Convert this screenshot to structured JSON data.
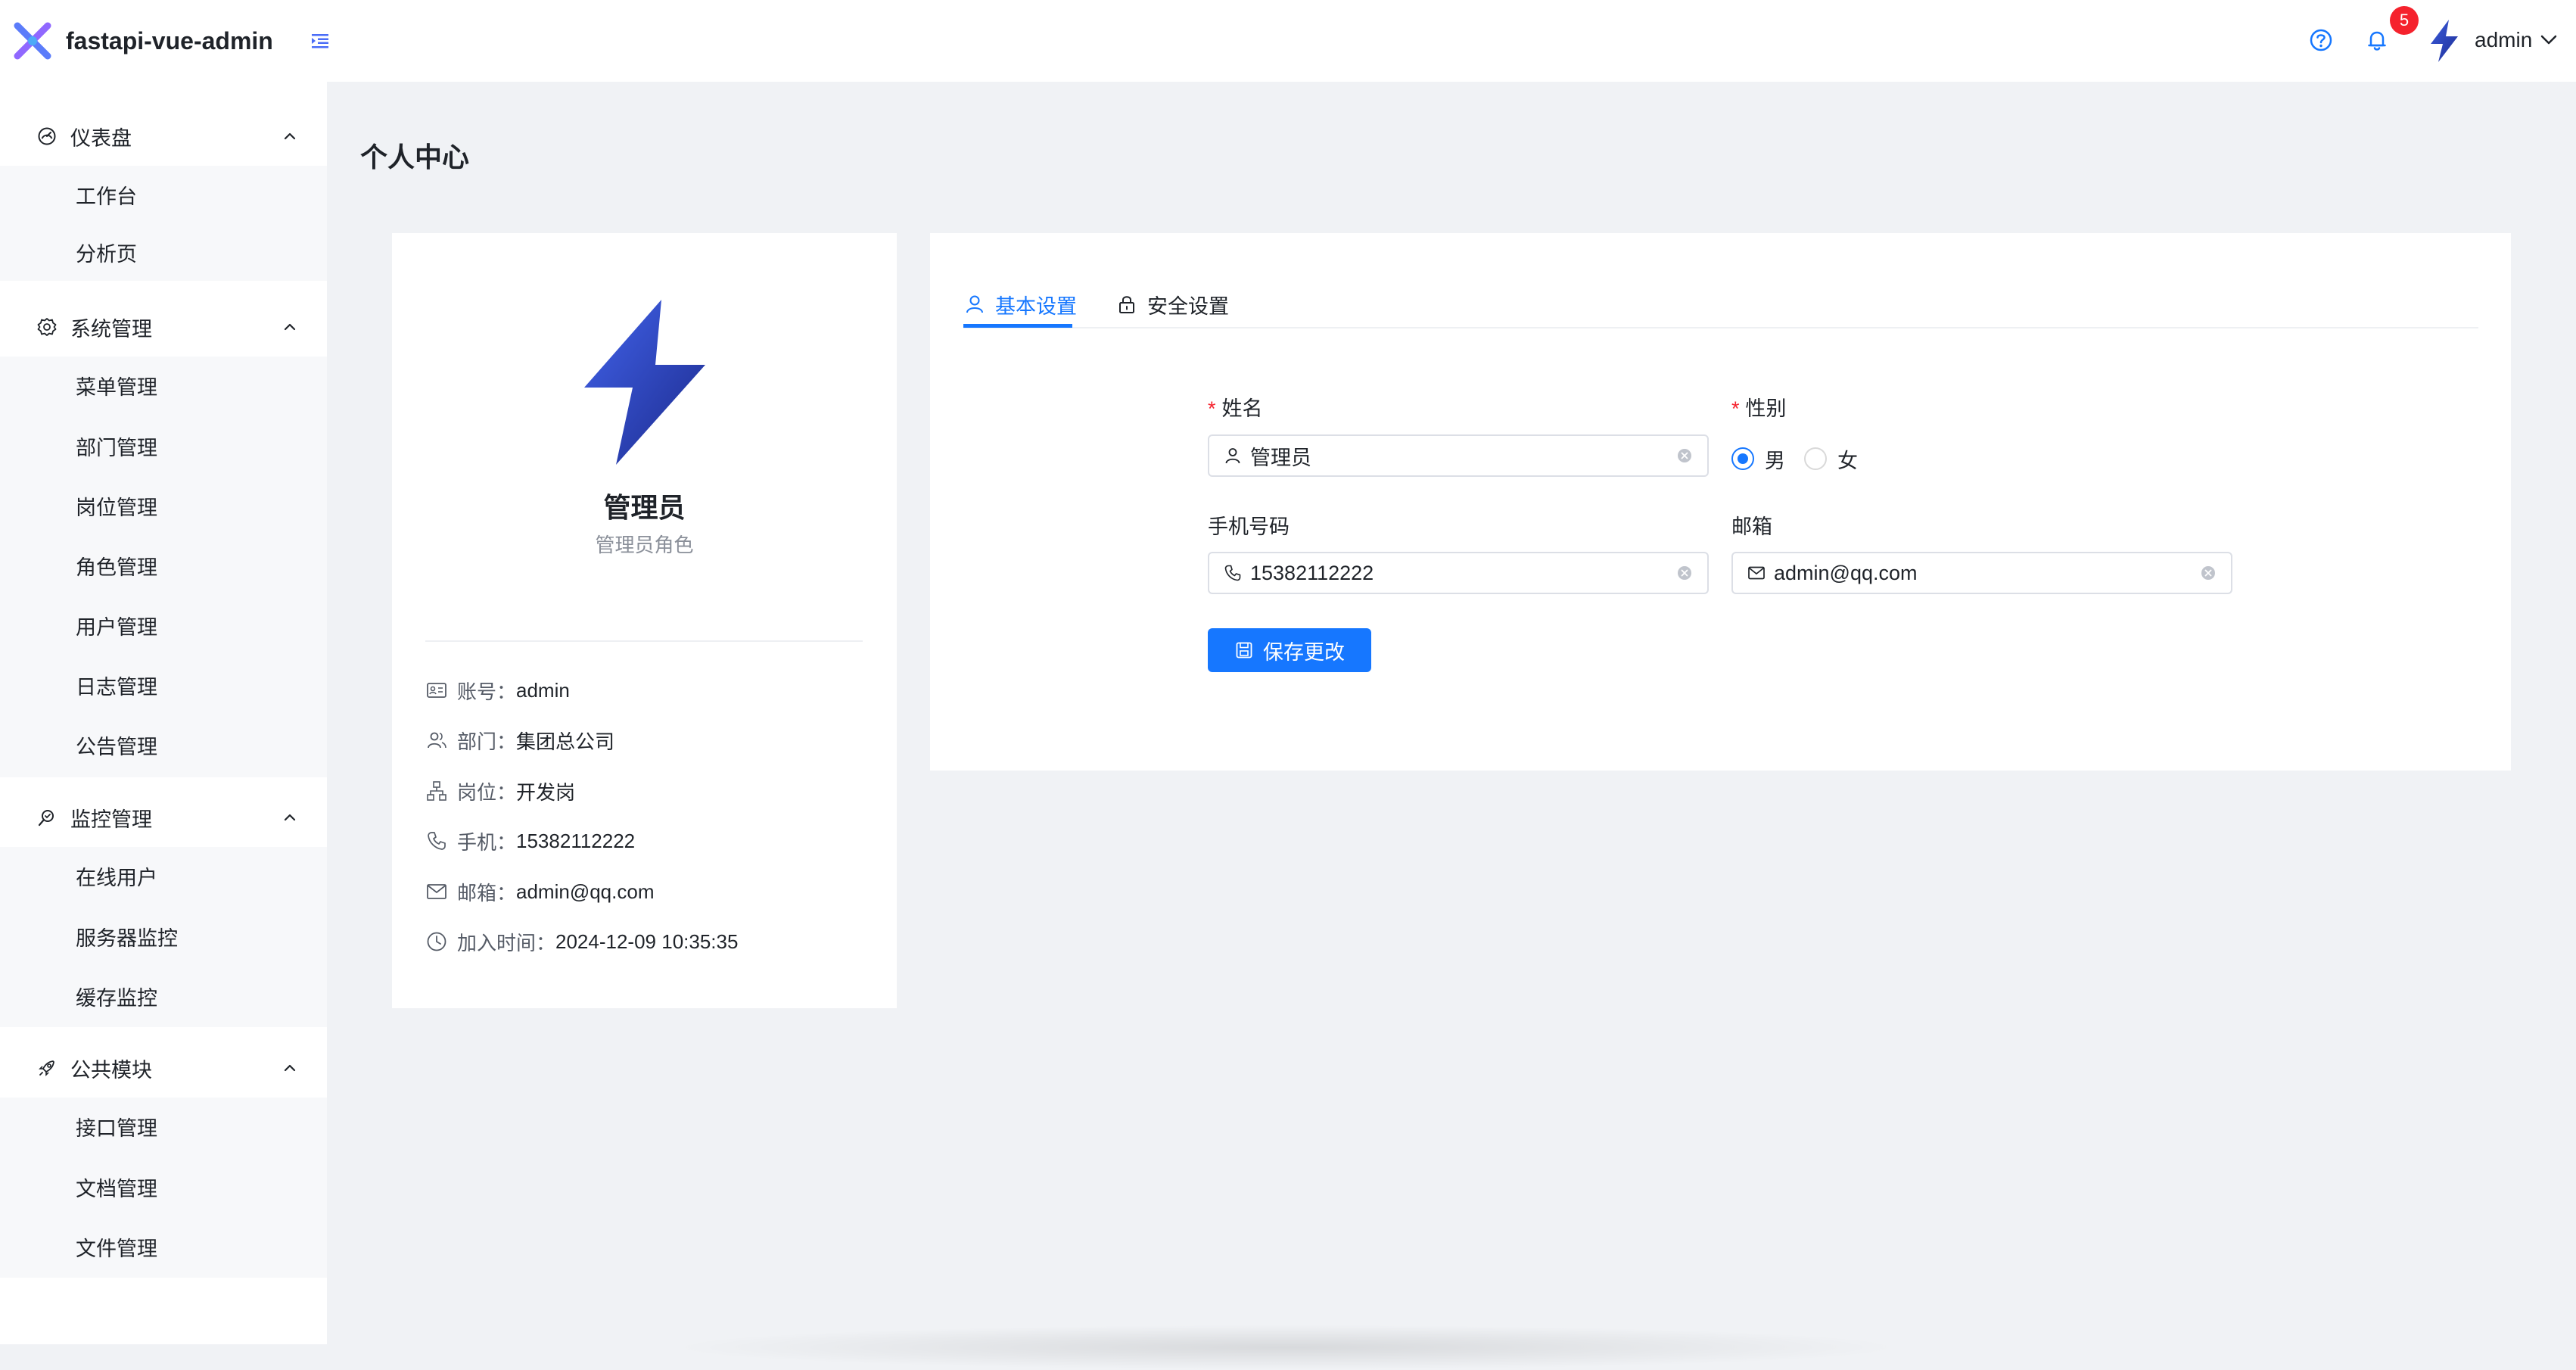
{
  "header": {
    "app_title": "fastapi-vue-admin",
    "notification_count": "5",
    "username": "admin"
  },
  "sidebar": {
    "groups": [
      {
        "label": "仪表盘",
        "icon": "dashboard-icon",
        "items": [
          "工作台",
          "分析页"
        ]
      },
      {
        "label": "系统管理",
        "icon": "gear-icon",
        "items": [
          "菜单管理",
          "部门管理",
          "岗位管理",
          "角色管理",
          "用户管理",
          "日志管理",
          "公告管理"
        ]
      },
      {
        "label": "监控管理",
        "icon": "monitor-icon",
        "items": [
          "在线用户",
          "服务器监控",
          "缓存监控"
        ]
      },
      {
        "label": "公共模块",
        "icon": "rocket-icon",
        "items": [
          "接口管理",
          "文档管理",
          "文件管理"
        ]
      }
    ]
  },
  "page_title": "个人中心",
  "profile": {
    "display_name": "管理员",
    "role": "管理员角色",
    "info": [
      {
        "key": "账号：",
        "value": "admin",
        "icon": "id-card-icon"
      },
      {
        "key": "部门：",
        "value": "集团总公司",
        "icon": "team-icon"
      },
      {
        "key": "岗位：",
        "value": "开发岗",
        "icon": "org-chart-icon"
      },
      {
        "key": "手机：",
        "value": "15382112222",
        "icon": "phone-icon"
      },
      {
        "key": "邮箱：",
        "value": "admin@qq.com",
        "icon": "mail-icon"
      },
      {
        "key": "加入时间：",
        "value": "2024-12-09 10:35:35",
        "icon": "clock-icon"
      }
    ]
  },
  "settings": {
    "tabs": [
      {
        "label": "基本设置",
        "icon": "user-icon",
        "active": true
      },
      {
        "label": "安全设置",
        "icon": "lock-icon",
        "active": false
      }
    ],
    "form": {
      "name_label": "姓名",
      "name_value": "管理员",
      "gender_label": "性别",
      "gender_options": [
        "男",
        "女"
      ],
      "gender_selected": "男",
      "phone_label": "手机号码",
      "phone_value": "15382112222",
      "email_label": "邮箱",
      "email_value": "admin@qq.com",
      "required_mark": "*",
      "save_label": "保存更改"
    }
  },
  "colors": {
    "primary": "#1677ff",
    "badge": "#f5222d",
    "brand_gradient": [
      "#3b5bdb",
      "#1e2f97"
    ]
  }
}
